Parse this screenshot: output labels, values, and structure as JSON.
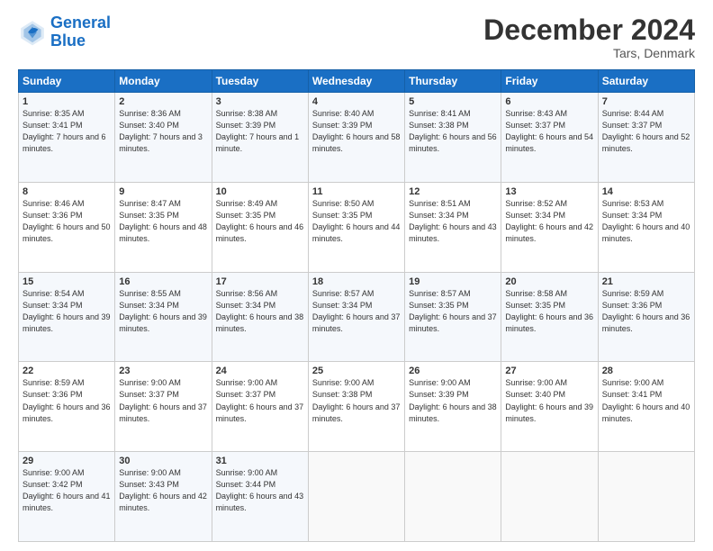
{
  "logo": {
    "line1": "General",
    "line2": "Blue"
  },
  "title": "December 2024",
  "location": "Tars, Denmark",
  "days_header": [
    "Sunday",
    "Monday",
    "Tuesday",
    "Wednesday",
    "Thursday",
    "Friday",
    "Saturday"
  ],
  "weeks": [
    [
      {
        "day": "1",
        "sunrise": "Sunrise: 8:35 AM",
        "sunset": "Sunset: 3:41 PM",
        "daylight": "Daylight: 7 hours and 6 minutes."
      },
      {
        "day": "2",
        "sunrise": "Sunrise: 8:36 AM",
        "sunset": "Sunset: 3:40 PM",
        "daylight": "Daylight: 7 hours and 3 minutes."
      },
      {
        "day": "3",
        "sunrise": "Sunrise: 8:38 AM",
        "sunset": "Sunset: 3:39 PM",
        "daylight": "Daylight: 7 hours and 1 minute."
      },
      {
        "day": "4",
        "sunrise": "Sunrise: 8:40 AM",
        "sunset": "Sunset: 3:39 PM",
        "daylight": "Daylight: 6 hours and 58 minutes."
      },
      {
        "day": "5",
        "sunrise": "Sunrise: 8:41 AM",
        "sunset": "Sunset: 3:38 PM",
        "daylight": "Daylight: 6 hours and 56 minutes."
      },
      {
        "day": "6",
        "sunrise": "Sunrise: 8:43 AM",
        "sunset": "Sunset: 3:37 PM",
        "daylight": "Daylight: 6 hours and 54 minutes."
      },
      {
        "day": "7",
        "sunrise": "Sunrise: 8:44 AM",
        "sunset": "Sunset: 3:37 PM",
        "daylight": "Daylight: 6 hours and 52 minutes."
      }
    ],
    [
      {
        "day": "8",
        "sunrise": "Sunrise: 8:46 AM",
        "sunset": "Sunset: 3:36 PM",
        "daylight": "Daylight: 6 hours and 50 minutes."
      },
      {
        "day": "9",
        "sunrise": "Sunrise: 8:47 AM",
        "sunset": "Sunset: 3:35 PM",
        "daylight": "Daylight: 6 hours and 48 minutes."
      },
      {
        "day": "10",
        "sunrise": "Sunrise: 8:49 AM",
        "sunset": "Sunset: 3:35 PM",
        "daylight": "Daylight: 6 hours and 46 minutes."
      },
      {
        "day": "11",
        "sunrise": "Sunrise: 8:50 AM",
        "sunset": "Sunset: 3:35 PM",
        "daylight": "Daylight: 6 hours and 44 minutes."
      },
      {
        "day": "12",
        "sunrise": "Sunrise: 8:51 AM",
        "sunset": "Sunset: 3:34 PM",
        "daylight": "Daylight: 6 hours and 43 minutes."
      },
      {
        "day": "13",
        "sunrise": "Sunrise: 8:52 AM",
        "sunset": "Sunset: 3:34 PM",
        "daylight": "Daylight: 6 hours and 42 minutes."
      },
      {
        "day": "14",
        "sunrise": "Sunrise: 8:53 AM",
        "sunset": "Sunset: 3:34 PM",
        "daylight": "Daylight: 6 hours and 40 minutes."
      }
    ],
    [
      {
        "day": "15",
        "sunrise": "Sunrise: 8:54 AM",
        "sunset": "Sunset: 3:34 PM",
        "daylight": "Daylight: 6 hours and 39 minutes."
      },
      {
        "day": "16",
        "sunrise": "Sunrise: 8:55 AM",
        "sunset": "Sunset: 3:34 PM",
        "daylight": "Daylight: 6 hours and 39 minutes."
      },
      {
        "day": "17",
        "sunrise": "Sunrise: 8:56 AM",
        "sunset": "Sunset: 3:34 PM",
        "daylight": "Daylight: 6 hours and 38 minutes."
      },
      {
        "day": "18",
        "sunrise": "Sunrise: 8:57 AM",
        "sunset": "Sunset: 3:34 PM",
        "daylight": "Daylight: 6 hours and 37 minutes."
      },
      {
        "day": "19",
        "sunrise": "Sunrise: 8:57 AM",
        "sunset": "Sunset: 3:35 PM",
        "daylight": "Daylight: 6 hours and 37 minutes."
      },
      {
        "day": "20",
        "sunrise": "Sunrise: 8:58 AM",
        "sunset": "Sunset: 3:35 PM",
        "daylight": "Daylight: 6 hours and 36 minutes."
      },
      {
        "day": "21",
        "sunrise": "Sunrise: 8:59 AM",
        "sunset": "Sunset: 3:36 PM",
        "daylight": "Daylight: 6 hours and 36 minutes."
      }
    ],
    [
      {
        "day": "22",
        "sunrise": "Sunrise: 8:59 AM",
        "sunset": "Sunset: 3:36 PM",
        "daylight": "Daylight: 6 hours and 36 minutes."
      },
      {
        "day": "23",
        "sunrise": "Sunrise: 9:00 AM",
        "sunset": "Sunset: 3:37 PM",
        "daylight": "Daylight: 6 hours and 37 minutes."
      },
      {
        "day": "24",
        "sunrise": "Sunrise: 9:00 AM",
        "sunset": "Sunset: 3:37 PM",
        "daylight": "Daylight: 6 hours and 37 minutes."
      },
      {
        "day": "25",
        "sunrise": "Sunrise: 9:00 AM",
        "sunset": "Sunset: 3:38 PM",
        "daylight": "Daylight: 6 hours and 37 minutes."
      },
      {
        "day": "26",
        "sunrise": "Sunrise: 9:00 AM",
        "sunset": "Sunset: 3:39 PM",
        "daylight": "Daylight: 6 hours and 38 minutes."
      },
      {
        "day": "27",
        "sunrise": "Sunrise: 9:00 AM",
        "sunset": "Sunset: 3:40 PM",
        "daylight": "Daylight: 6 hours and 39 minutes."
      },
      {
        "day": "28",
        "sunrise": "Sunrise: 9:00 AM",
        "sunset": "Sunset: 3:41 PM",
        "daylight": "Daylight: 6 hours and 40 minutes."
      }
    ],
    [
      {
        "day": "29",
        "sunrise": "Sunrise: 9:00 AM",
        "sunset": "Sunset: 3:42 PM",
        "daylight": "Daylight: 6 hours and 41 minutes."
      },
      {
        "day": "30",
        "sunrise": "Sunrise: 9:00 AM",
        "sunset": "Sunset: 3:43 PM",
        "daylight": "Daylight: 6 hours and 42 minutes."
      },
      {
        "day": "31",
        "sunrise": "Sunrise: 9:00 AM",
        "sunset": "Sunset: 3:44 PM",
        "daylight": "Daylight: 6 hours and 43 minutes."
      },
      null,
      null,
      null,
      null
    ]
  ]
}
